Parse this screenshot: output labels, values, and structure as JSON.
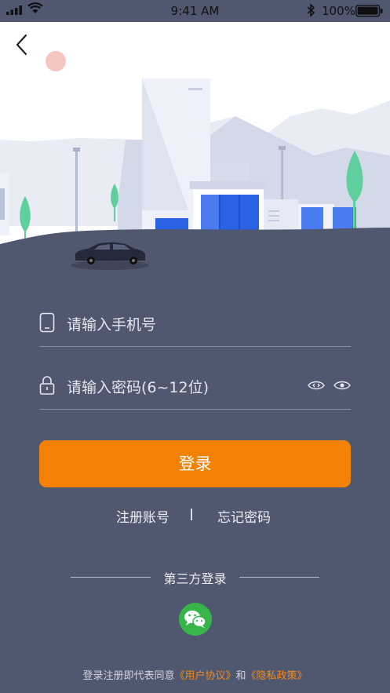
{
  "status_bar": {
    "time": "9:41 AM",
    "battery": "100%"
  },
  "form": {
    "phone_placeholder": "请输入手机号",
    "password_placeholder": "请输入密码(6~12位)"
  },
  "login_button": "登录",
  "links": {
    "register": "注册账号",
    "forgot": "忘记密码"
  },
  "third_party": {
    "label": "第三方登录"
  },
  "agreement": {
    "prefix": "登录注册即代表同意",
    "user_agreement": "《用户协议》",
    "and": "和",
    "privacy_policy": "《隐私政策》"
  },
  "colors": {
    "accent": "#f28105",
    "panel": "#505870",
    "wechat": "#38b548",
    "link": "#f28a1c"
  }
}
